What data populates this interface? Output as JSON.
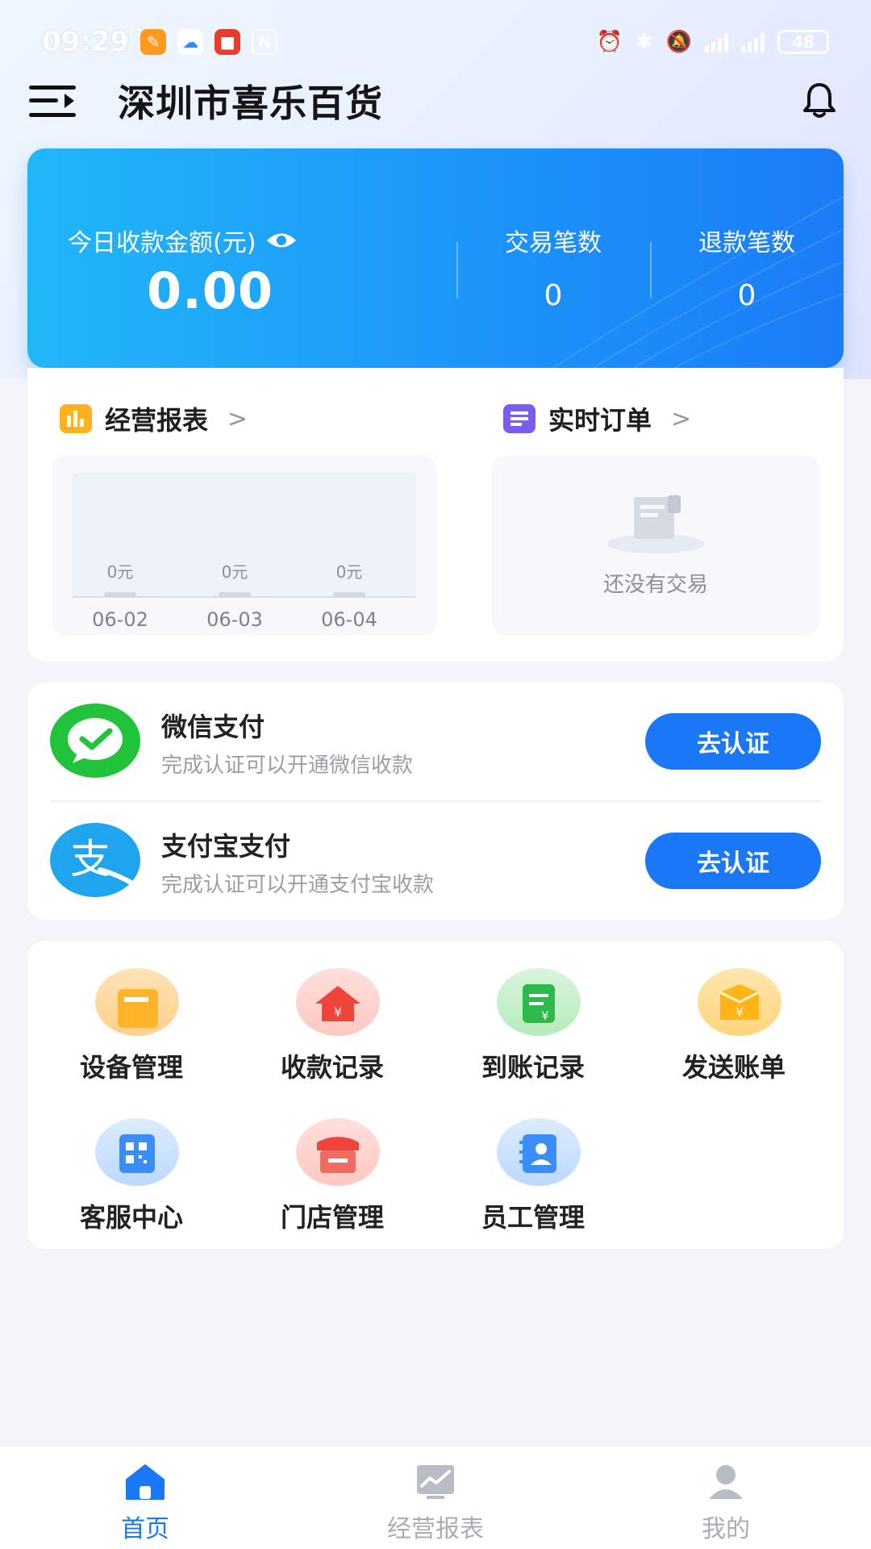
{
  "status_bar": {
    "time": "09:29",
    "battery": "48"
  },
  "header": {
    "title": "深圳市喜乐百货"
  },
  "revenue": {
    "label": "今日收款金额(元)",
    "amount": "0.00",
    "transactions_label": "交易笔数",
    "transactions_value": "0",
    "refunds_label": "退款笔数",
    "refunds_value": "0"
  },
  "report": {
    "business_report_title": "经营报表",
    "realtime_orders_title": "实时订单",
    "empty_text": "还没有交易",
    "chart_data": {
      "type": "bar",
      "categories": [
        "06-02",
        "06-03",
        "06-04"
      ],
      "values": [
        0,
        0,
        0
      ],
      "value_labels": [
        "0元",
        "0元",
        "0元"
      ]
    }
  },
  "payments": [
    {
      "name": "微信支付",
      "desc": "完成认证可以开通微信收款",
      "button": "去认证"
    },
    {
      "name": "支付宝支付",
      "desc": "完成认证可以开通支付宝收款",
      "button": "去认证"
    }
  ],
  "features": [
    {
      "label": "设备管理",
      "icon": "device-icon"
    },
    {
      "label": "收款记录",
      "icon": "payment-record-icon"
    },
    {
      "label": "到账记录",
      "icon": "arrival-record-icon"
    },
    {
      "label": "发送账单",
      "icon": "send-bill-icon"
    },
    {
      "label": "客服中心",
      "icon": "customer-service-icon"
    },
    {
      "label": "门店管理",
      "icon": "store-icon"
    },
    {
      "label": "员工管理",
      "icon": "staff-icon"
    }
  ],
  "nav": [
    {
      "label": "首页",
      "active": true
    },
    {
      "label": "经营报表",
      "active": false
    },
    {
      "label": "我的",
      "active": false
    }
  ],
  "colors": {
    "primary": "#1a78f7",
    "wechat": "#20c33a",
    "alipay": "#1ea5ee",
    "nav_inactive": "#a9adb5"
  }
}
